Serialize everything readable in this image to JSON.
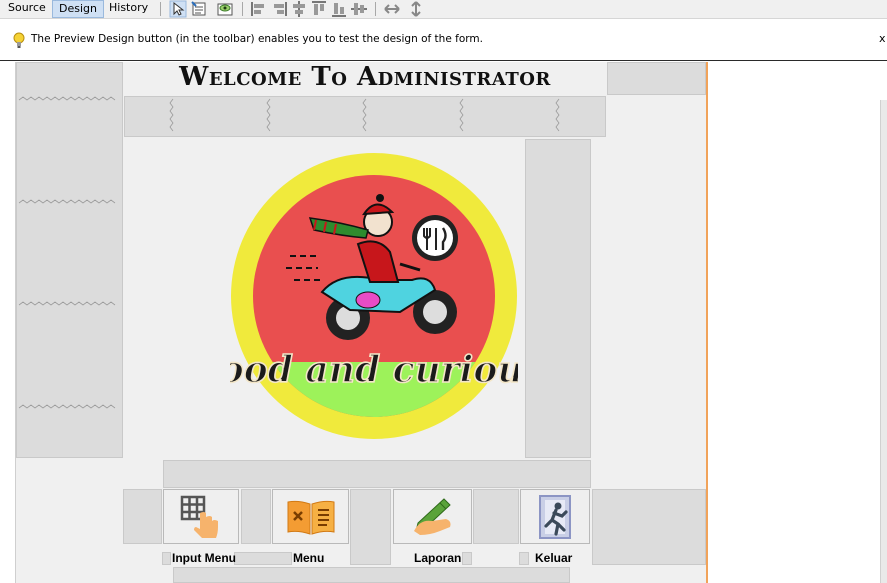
{
  "toolbar": {
    "tabs": [
      {
        "label": "Source",
        "active": false
      },
      {
        "label": "Design",
        "active": true
      },
      {
        "label": "History",
        "active": false
      }
    ]
  },
  "hint": {
    "text": "The Preview Design button (in the toolbar) enables you to test the design of the form.",
    "close": "x"
  },
  "form": {
    "title": "Welcome To Administrator",
    "logo_text": "food and curious",
    "buttons": [
      {
        "label": "Input Menu",
        "icon": "grid-hand-icon"
      },
      {
        "label": "Menu",
        "icon": "menu-book-icon"
      },
      {
        "label": "Laporan",
        "icon": "pen-hand-icon"
      },
      {
        "label": "Keluar",
        "icon": "exit-door-icon"
      }
    ]
  },
  "colors": {
    "accent_border": "#f1a35a",
    "selected_tab": "#cfe0f4",
    "logo_outer": "#f0ea3c",
    "logo_inner_red": "#e94f4f",
    "logo_inner_green": "#9df25a"
  }
}
